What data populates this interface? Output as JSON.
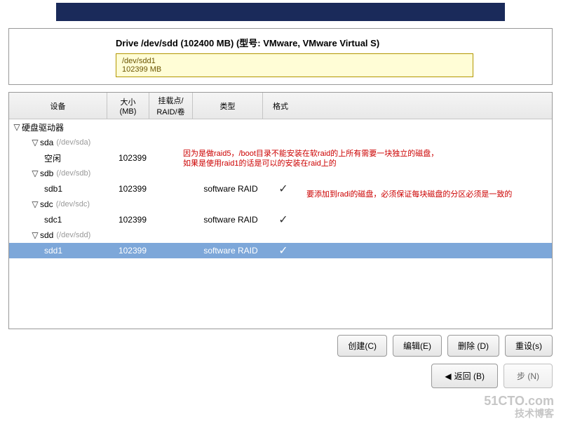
{
  "drive_title": "Drive /dev/sdd (102400 MB) (型号: VMware, VMware Virtual S)",
  "drive_box_line1": "/dev/sdd1",
  "drive_box_line2": "102399 MB",
  "headers": {
    "device": "设备",
    "size1": "大小",
    "size2": "(MB)",
    "mount1": "挂载点/",
    "mount2": "RAID/卷",
    "type": "类型",
    "format": "格式"
  },
  "rows": {
    "hdd_label": "硬盘驱动器",
    "sda": "sda",
    "sda_path": "(/dev/sda)",
    "sda_free": "空闲",
    "sda_free_size": "102399",
    "sdb": "sdb",
    "sdb_path": "(/dev/sdb)",
    "sdb1": "sdb1",
    "sdb1_size": "102399",
    "sdb1_type": "software RAID",
    "sdc": "sdc",
    "sdc_path": "(/dev/sdc)",
    "sdc1": "sdc1",
    "sdc1_size": "102399",
    "sdc1_type": "software RAID",
    "sdd": "sdd",
    "sdd_path": "(/dev/sdd)",
    "sdd1": "sdd1",
    "sdd1_size": "102399",
    "sdd1_type": "software RAID"
  },
  "check": "✓",
  "triangle_down": "▽",
  "annotations": {
    "a1_l1": "因为是做raid5，/boot目录不能安装在软raid的上所有需要一块独立的磁盘，",
    "a1_l2": "如果是使用raid1的话是可以的安装在raid上的",
    "a2": "要添加到radi的磁盘，必须保证每块磁盘的分区必须是一致的"
  },
  "buttons": {
    "create": "创建(C)",
    "edit": "编辑(E)",
    "delete": "删除 (D)",
    "reset": "重设(s)",
    "back": "返回 (B)",
    "next": "步 (N)"
  },
  "watermark1": "51CTO.com",
  "watermark2": "技术博客"
}
